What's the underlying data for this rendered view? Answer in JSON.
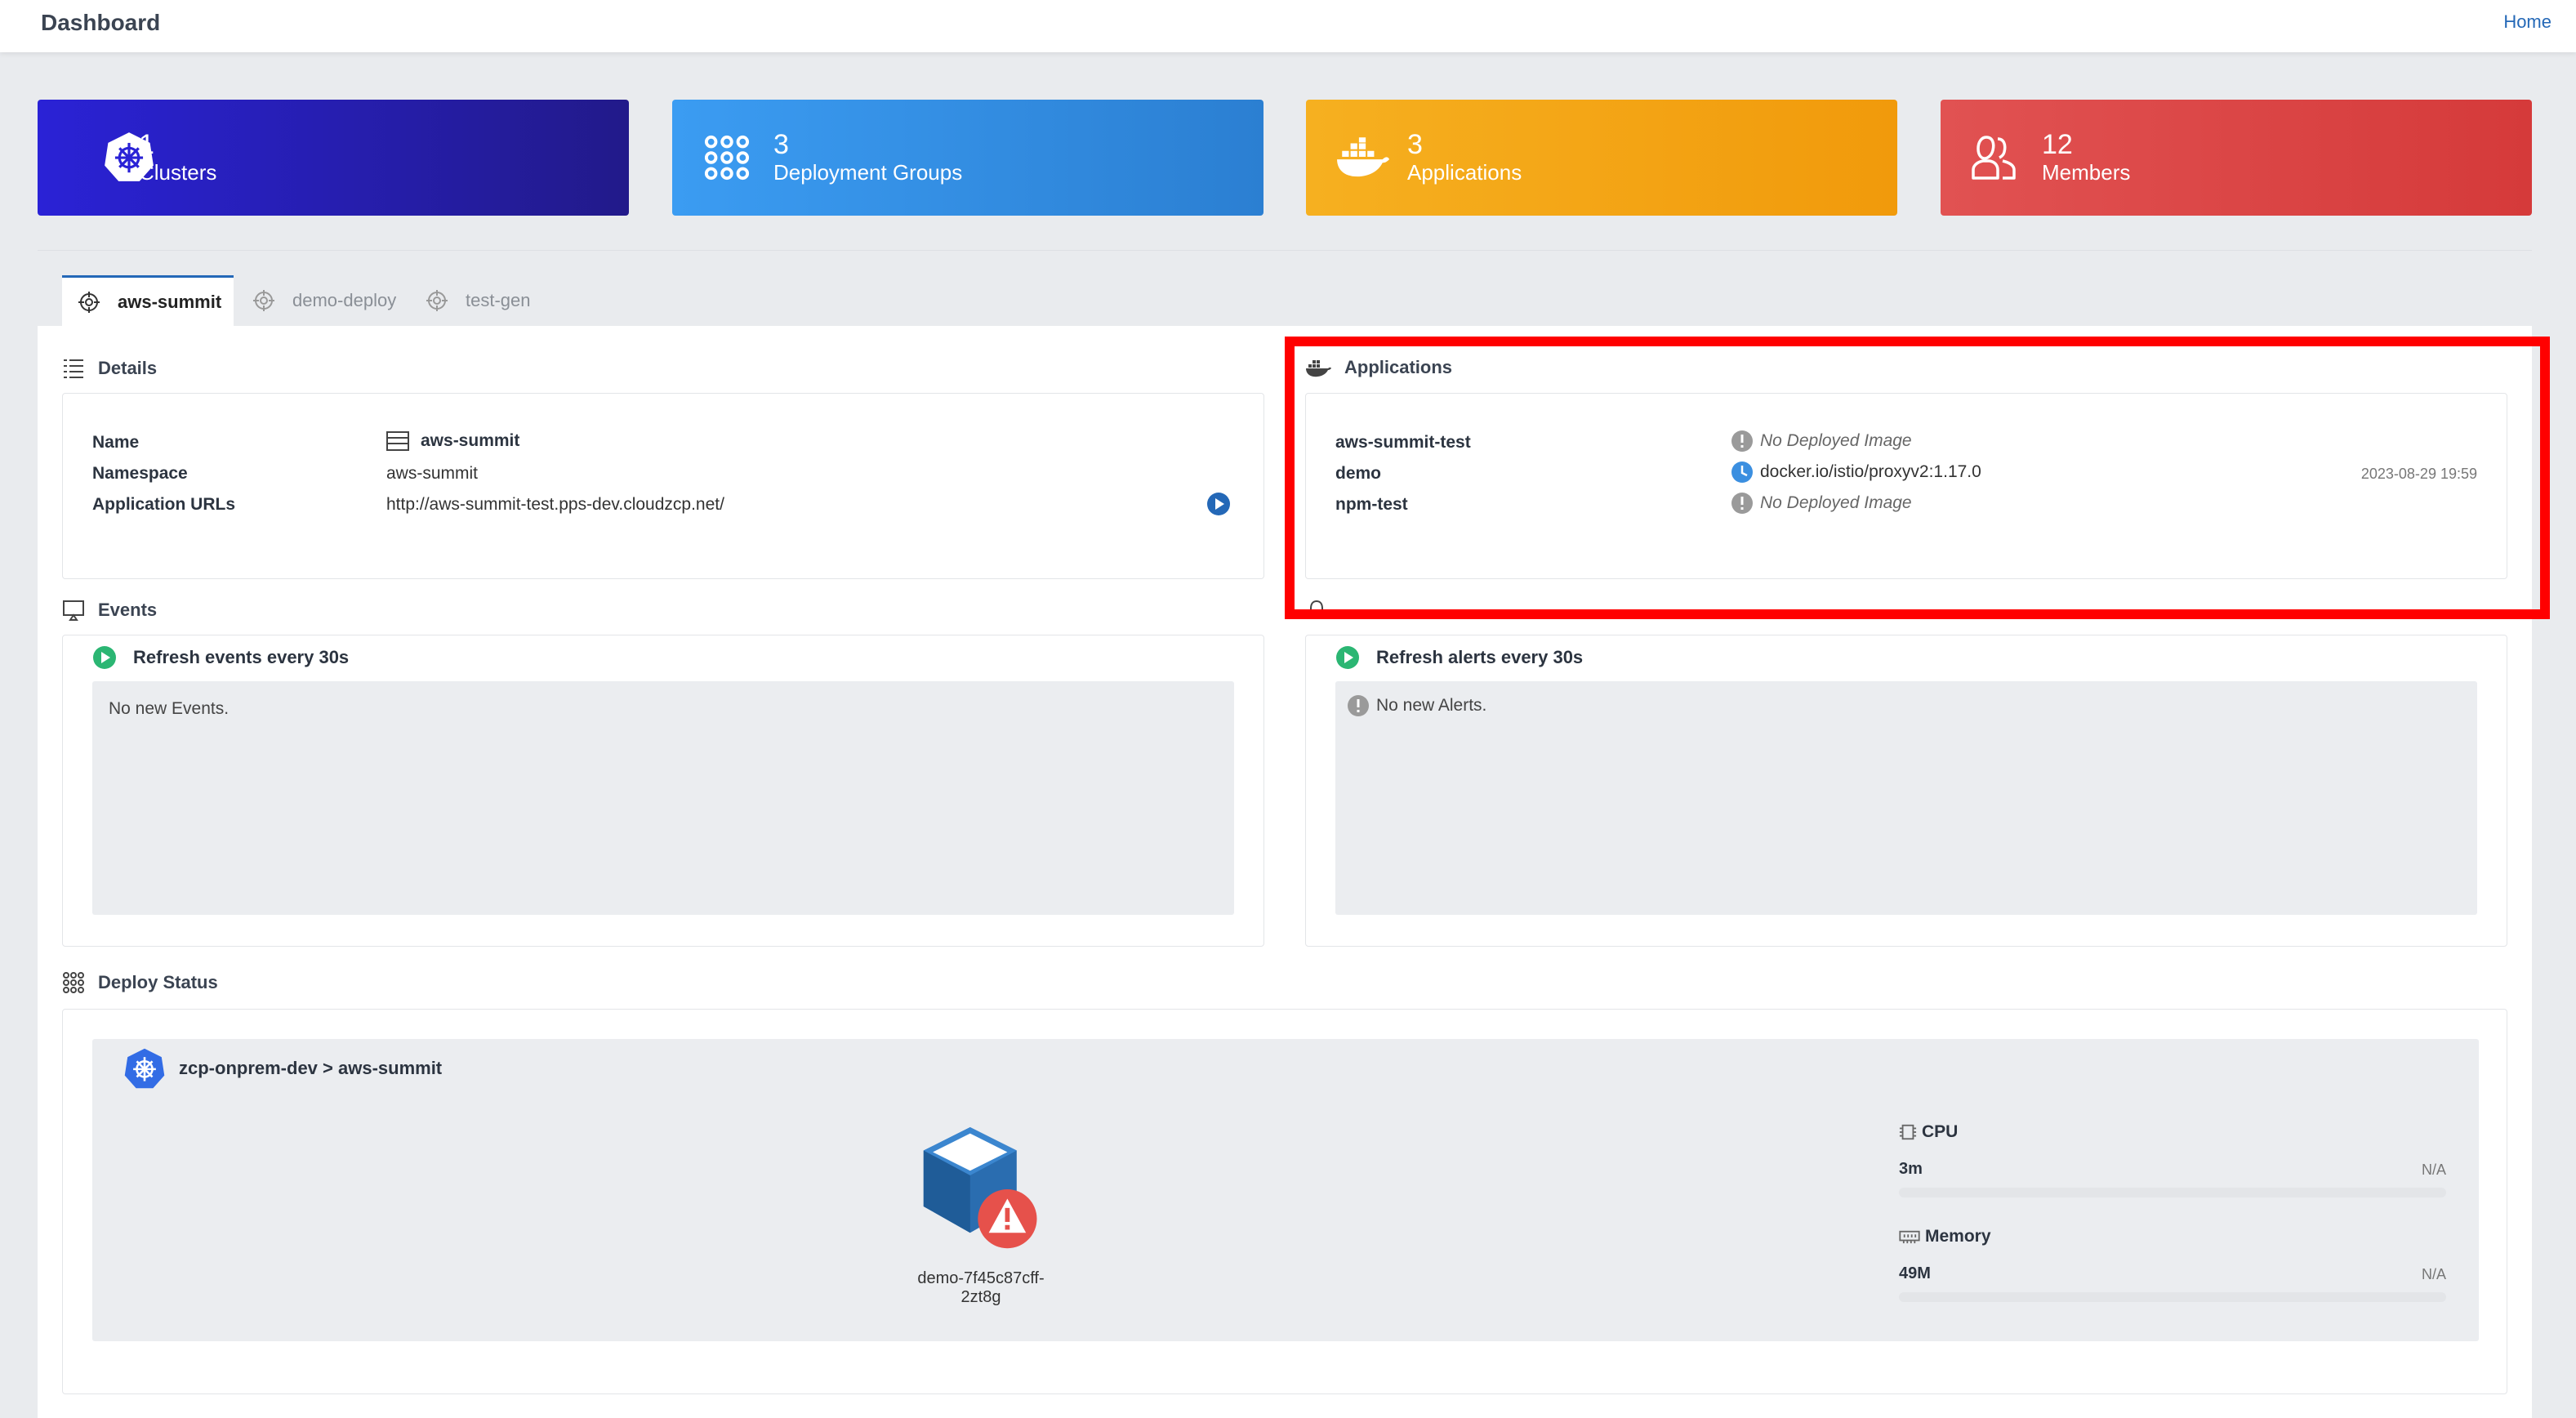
{
  "header": {
    "title": "Dashboard",
    "home_link": "Home"
  },
  "stats": [
    {
      "value": "1",
      "label": "Clusters",
      "icon": "kubernetes-icon",
      "color": "#2a22d6"
    },
    {
      "value": "3",
      "label": "Deployment Groups",
      "icon": "grid-dots-icon",
      "color": "#3b9cf2"
    },
    {
      "value": "3",
      "label": "Applications",
      "icon": "docker-icon",
      "color": "#f6b020"
    },
    {
      "value": "12",
      "label": "Members",
      "icon": "users-icon",
      "color": "#e15252"
    }
  ],
  "tabs": [
    {
      "label": "aws-summit",
      "active": true
    },
    {
      "label": "demo-deploy",
      "active": false
    },
    {
      "label": "test-gen",
      "active": false
    }
  ],
  "details": {
    "title": "Details",
    "name_label": "Name",
    "name_value": "aws-summit",
    "namespace_label": "Namespace",
    "namespace_value": "aws-summit",
    "urls_label": "Application URLs",
    "urls_value": "http://aws-summit-test.pps-dev.cloudzcp.net/"
  },
  "applications": {
    "title": "Applications",
    "items": [
      {
        "name": "aws-summit-test",
        "status": "No Deployed Image",
        "date": ""
      },
      {
        "name": "demo",
        "status": "docker.io/istio/proxyv2:1.17.0",
        "date": "2023-08-29 19:59"
      },
      {
        "name": "npm-test",
        "status": "No Deployed Image",
        "date": ""
      }
    ]
  },
  "events": {
    "title": "Events",
    "refresh": "Refresh events every 30s",
    "empty": "No new Events."
  },
  "alerts": {
    "refresh": "Refresh alerts every 30s",
    "empty": "No new Alerts."
  },
  "deploy_status": {
    "title": "Deploy Status",
    "path": "zcp-onprem-dev > aws-summit",
    "pod": "demo-7f45c87cff-2zt8g",
    "cpu_label": "CPU",
    "cpu_value": "3m",
    "cpu_limit": "N/A",
    "memory_label": "Memory",
    "memory_value": "49M",
    "memory_limit": "N/A"
  }
}
